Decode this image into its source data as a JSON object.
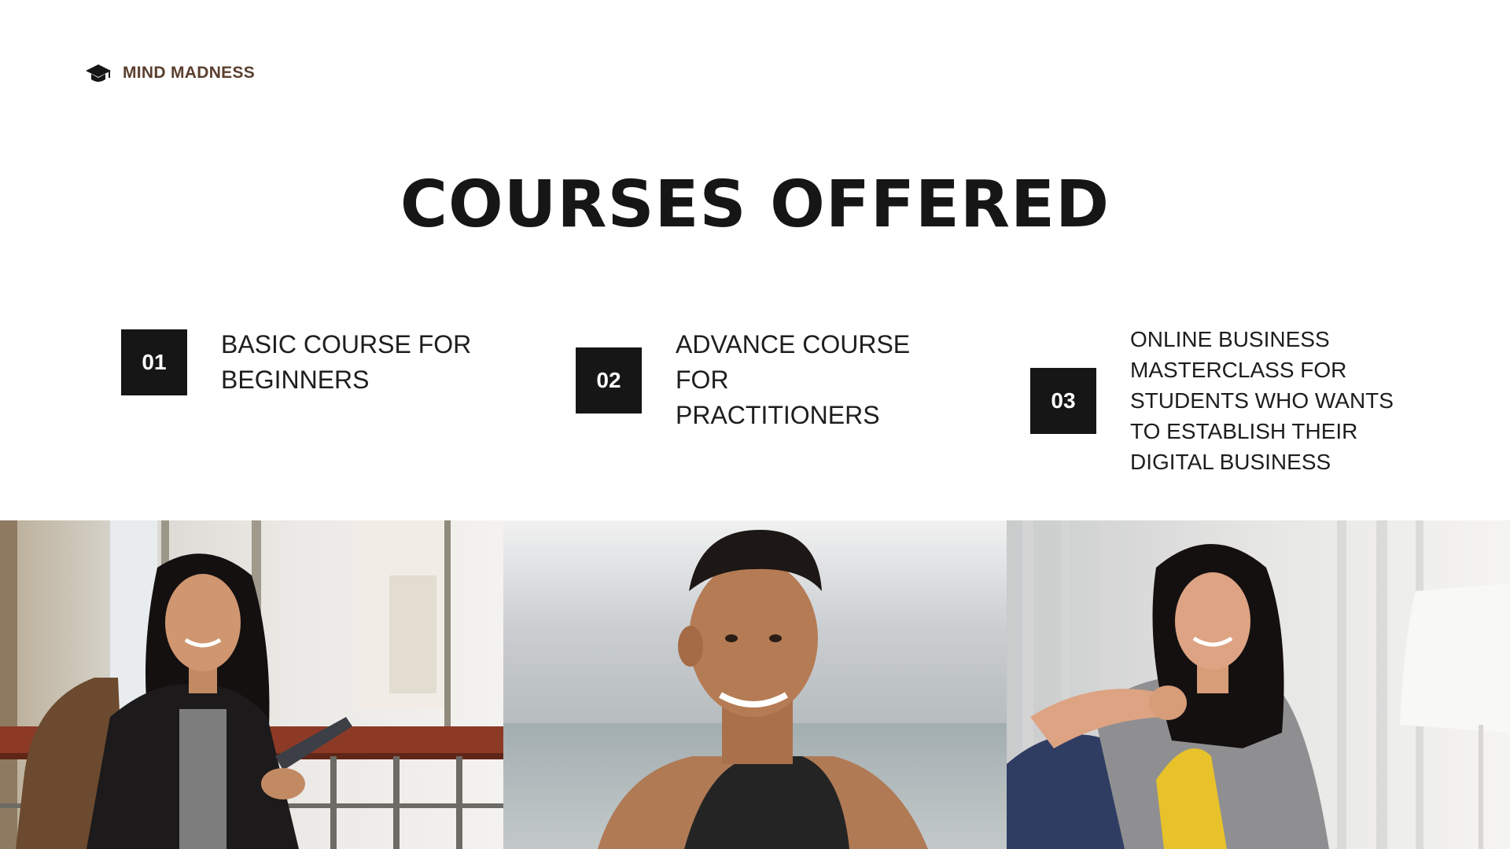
{
  "brand": {
    "name": "MIND MADNESS",
    "icon": "graduation-cap-icon"
  },
  "title": "COURSES OFFERED",
  "courses": [
    {
      "number": "01",
      "label": "BASIC COURSE FOR BEGINNERS"
    },
    {
      "number": "02",
      "label": "ADVANCE COURSE FOR PRACTITIONERS"
    },
    {
      "number": "03",
      "label": "ONLINE BUSINESS MASTERCLASS FOR STUDENTS WHO WANTS TO ESTABLISH THEIR DIGITAL BUSINESS"
    }
  ],
  "colors": {
    "background": "#ffffff",
    "heading": "#161616",
    "number_box": "#161616",
    "brand_text": "#5a3e2e"
  },
  "photos": [
    {
      "name": "student-woman-with-backpack-photo"
    },
    {
      "name": "smiling-man-by-sea-photo"
    },
    {
      "name": "woman-sitting-indoors-photo"
    }
  ]
}
